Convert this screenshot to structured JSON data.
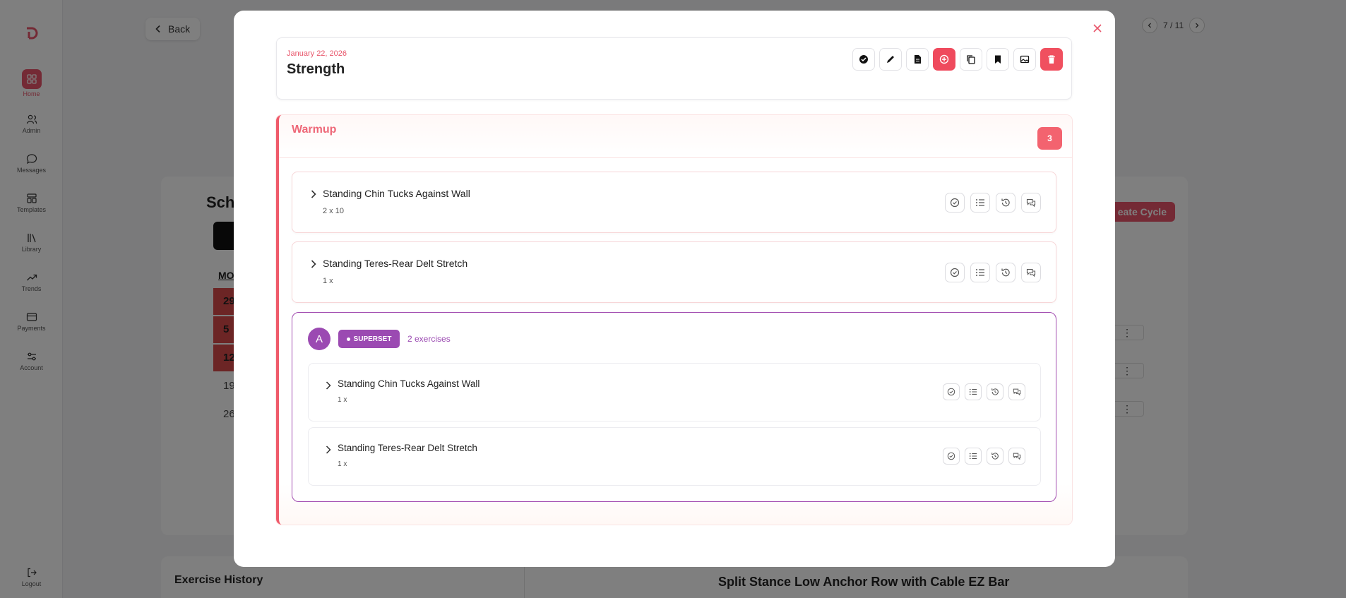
{
  "sidebar": {
    "items": [
      {
        "label": "Home",
        "icon": "grid-icon",
        "active": true
      },
      {
        "label": "Admin",
        "icon": "users-icon"
      },
      {
        "label": "Messages",
        "icon": "chat-icon"
      },
      {
        "label": "Templates",
        "icon": "templates-icon"
      },
      {
        "label": "Library",
        "icon": "library-icon"
      },
      {
        "label": "Trends",
        "icon": "trend-icon"
      },
      {
        "label": "Payments",
        "icon": "card-icon"
      },
      {
        "label": "Account",
        "icon": "sliders-icon"
      }
    ],
    "logout": "Logout"
  },
  "page": {
    "back": "Back",
    "pager": "7 / 11",
    "schedule_title": "Sche",
    "create_cycle": "eate Cycle",
    "calendar": {
      "mo": "MO",
      "days": [
        "29",
        "5",
        "12",
        "19",
        "26"
      ]
    },
    "history_title": "Exercise History",
    "history_exercise": "Split Stance Low Anchor Row with Cable EZ Bar",
    "row_menu": "⋮"
  },
  "modal": {
    "date": "January 22, 2026",
    "title": "Strength",
    "section": {
      "title": "Warmup",
      "count": "3",
      "exercises": [
        {
          "name": "Standing Chin Tucks Against Wall",
          "sets": "2 x 10"
        },
        {
          "name": "Standing Teres-Rear Delt Stretch",
          "sets": "1 x"
        }
      ],
      "superset": {
        "letter": "A",
        "badge": "SUPERSET",
        "count": "2 exercises",
        "exercises": [
          {
            "name": "Standing Chin Tucks Against Wall",
            "sets": "1 x"
          },
          {
            "name": "Standing Teres-Rear Delt Stretch",
            "sets": "1 x"
          }
        ]
      }
    }
  },
  "colors": {
    "accent": "#e8556a",
    "superset": "#9b4ab2"
  }
}
